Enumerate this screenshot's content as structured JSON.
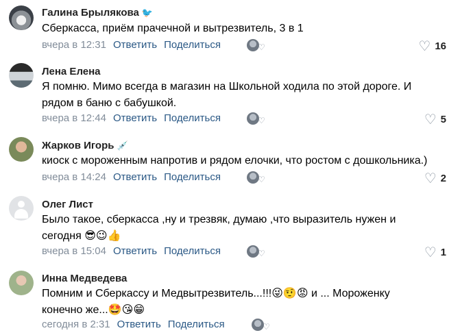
{
  "actions": {
    "reply": "Ответить",
    "share": "Поделиться"
  },
  "comments": [
    {
      "author": "Галина Брылякова",
      "badge": "🐦",
      "text": "Сберкасса, приём прачечной и вытрезвитель, 3 в 1",
      "time": "вчера в 12:31",
      "likes": "16"
    },
    {
      "author": "Лена Елена",
      "text_line1": "Я помню. Мимо всегда в магазин на Школьной ходила по этой дороге. И",
      "text_line2": "рядом в баню с бабушкой.",
      "time": "вчера в 12:44",
      "likes": "5"
    },
    {
      "author": "Жарков Игорь",
      "badge": "💉",
      "text": "киоск с мороженным напротив и рядом елочки, что ростом с дошкольника.)",
      "time": "вчера в 14:24",
      "likes": "2"
    },
    {
      "author": "Олег Лист",
      "text_line1": "Было такое, сберкасса ,ну и трезвяк, думаю ,что выразитель нужен и",
      "text_line2": "сегодня",
      "emojis": "😎😉👍",
      "time": "вчера в 15:04",
      "likes": "1"
    },
    {
      "author": "Инна Медведева",
      "text_line1a": "Помним и Сберкассу и Медвытрезвитель...!!!",
      "emojis1": "😜🤨😡",
      "text_line1b": " и ... Мороженку",
      "text_line2": "конечно же...",
      "emojis2": "🤩😘😁",
      "time": "сегодня в 2:31"
    }
  ]
}
